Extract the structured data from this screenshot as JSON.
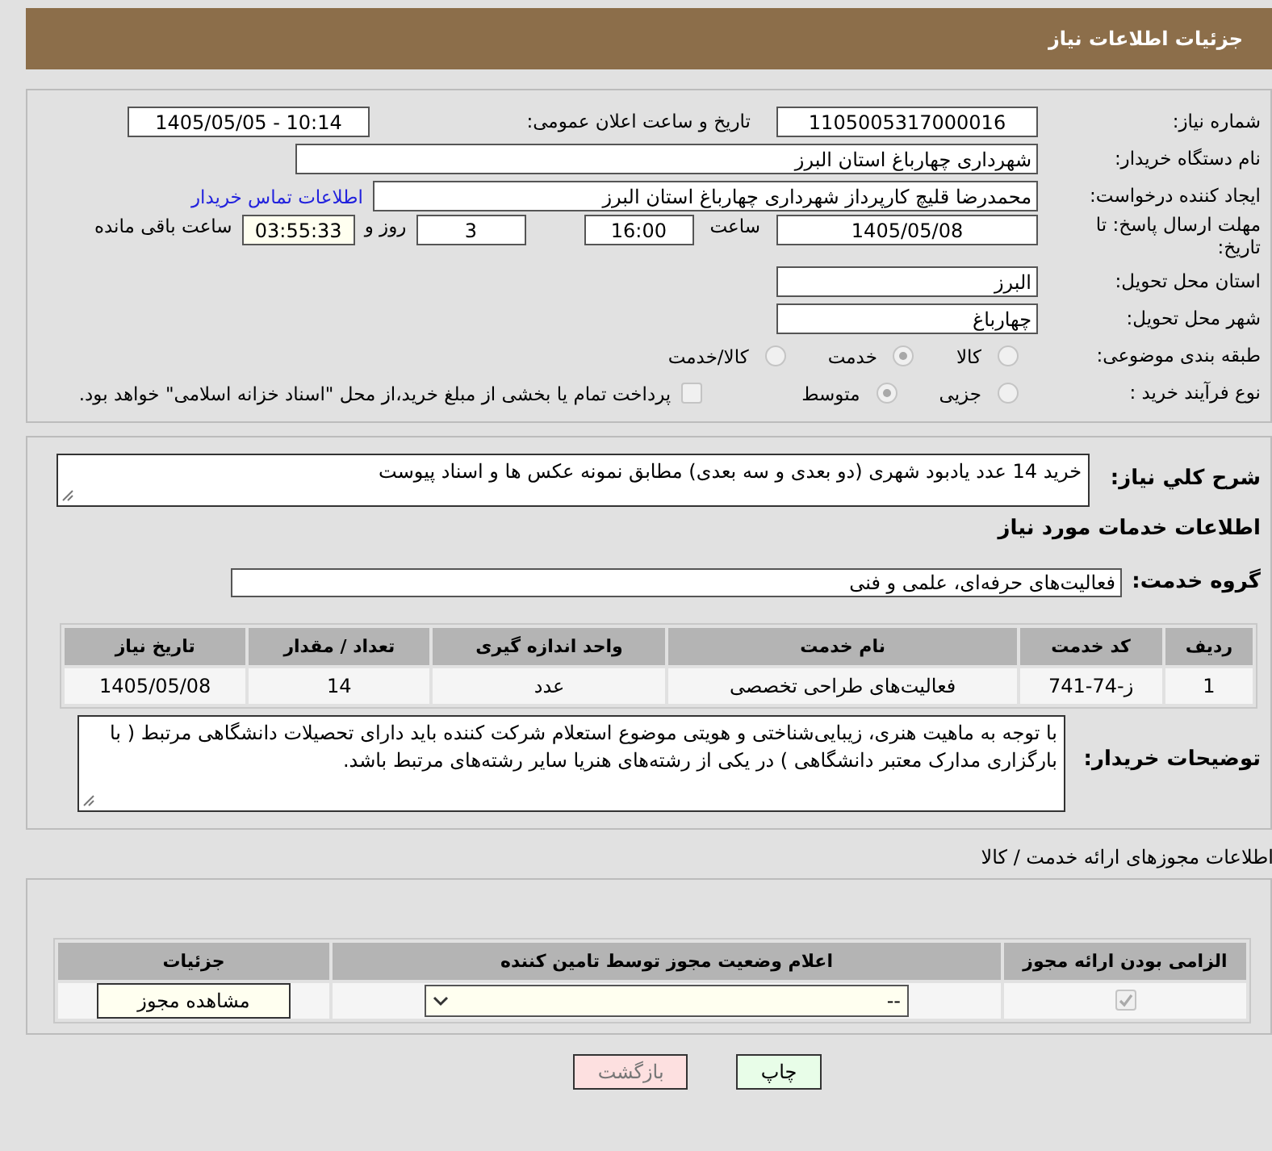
{
  "header": {
    "title": "جزئیات اطلاعات نیاز"
  },
  "need": {
    "number": {
      "label": "شماره نیاز:",
      "value": "1105005317000016"
    },
    "announce": {
      "label": "تاریخ و ساعت اعلان عمومی:",
      "value": "1405/05/05 - 10:14"
    },
    "buyer": {
      "label": "نام دستگاه خریدار:",
      "value": "شهرداری چهارباغ استان البرز"
    },
    "requester": {
      "label": "ایجاد کننده درخواست:",
      "value": "محمدرضا قلیچ کارپرداز شهرداری چهارباغ استان البرز",
      "link": "اطلاعات تماس خریدار"
    },
    "deadline": {
      "label": "مهلت ارسال پاسخ: تا تاریخ:",
      "date": "1405/05/08",
      "time_label": "ساعت",
      "time": "16:00",
      "days": "3",
      "days_label": "روز و",
      "remaining": "03:55:33",
      "remaining_label": "ساعت باقی مانده"
    },
    "province": {
      "label": "استان محل تحویل:",
      "value": "البرز"
    },
    "city": {
      "label": "شهر محل تحویل:",
      "value": "چهارباغ"
    },
    "category": {
      "label": "طبقه بندی موضوعی:",
      "options": [
        {
          "label": "کالا",
          "selected": false
        },
        {
          "label": "خدمت",
          "selected": true
        },
        {
          "label": "کالا/خدمت",
          "selected": false
        }
      ]
    },
    "process": {
      "label": "نوع فرآیند خرید :",
      "options": [
        {
          "label": "جزیی",
          "selected": false
        },
        {
          "label": "متوسط",
          "selected": true
        }
      ],
      "payment": {
        "label": "پرداخت تمام یا بخشی از مبلغ خرید،از محل \"اسناد خزانه اسلامی\" خواهد بود.",
        "checked": false
      }
    }
  },
  "details": {
    "description": {
      "label": "شرح کلي نياز:",
      "value": "خرید 14 عدد یادبود شهری (دو بعدی و سه بعدی) مطابق نمونه عکس ها و  اسناد پیوست"
    },
    "services_title": "اطلاعات خدمات مورد نياز",
    "service_group": {
      "label": "گروه خدمت:",
      "value": "فعالیت‌های حرفه‌ای، علمی و فنی"
    },
    "table": {
      "columns": [
        "ردیف",
        "کد خدمت",
        "نام خدمت",
        "واحد اندازه گیری",
        "تعداد / مقدار",
        "تاریخ نیاز"
      ],
      "rows": [
        [
          "1",
          "ز-74-741",
          "فعالیت‌های طراحی تخصصی",
          "عدد",
          "14",
          "1405/05/08"
        ]
      ]
    },
    "notes": {
      "label": "توضیحات خریدار:",
      "value": "با توجه به ماهیت هنری، زیبایی‌شناختی و هویتی موضوع استعلام شرکت کننده باید دارای تحصیلات دانشگاهی مرتبط ( با بارگزاری مدارک معتبر دانشگاهی ) در یکی از رشته‌های هنریا سایر رشته‌های مرتبط باشد."
    }
  },
  "permits": {
    "title": "اطلاعات مجوزهای ارائه خدمت / کالا",
    "columns": [
      "الزامی بودن ارائه مجوز",
      "اعلام وضعیت مجوز توسط تامین کننده",
      "جزئیات"
    ],
    "rows": [
      {
        "required": true,
        "status": "--",
        "button": "مشاهده مجوز"
      }
    ]
  },
  "buttons": [
    {
      "label": "چاپ",
      "kind": "print"
    },
    {
      "label": "بازگشت",
      "kind": "back"
    }
  ]
}
